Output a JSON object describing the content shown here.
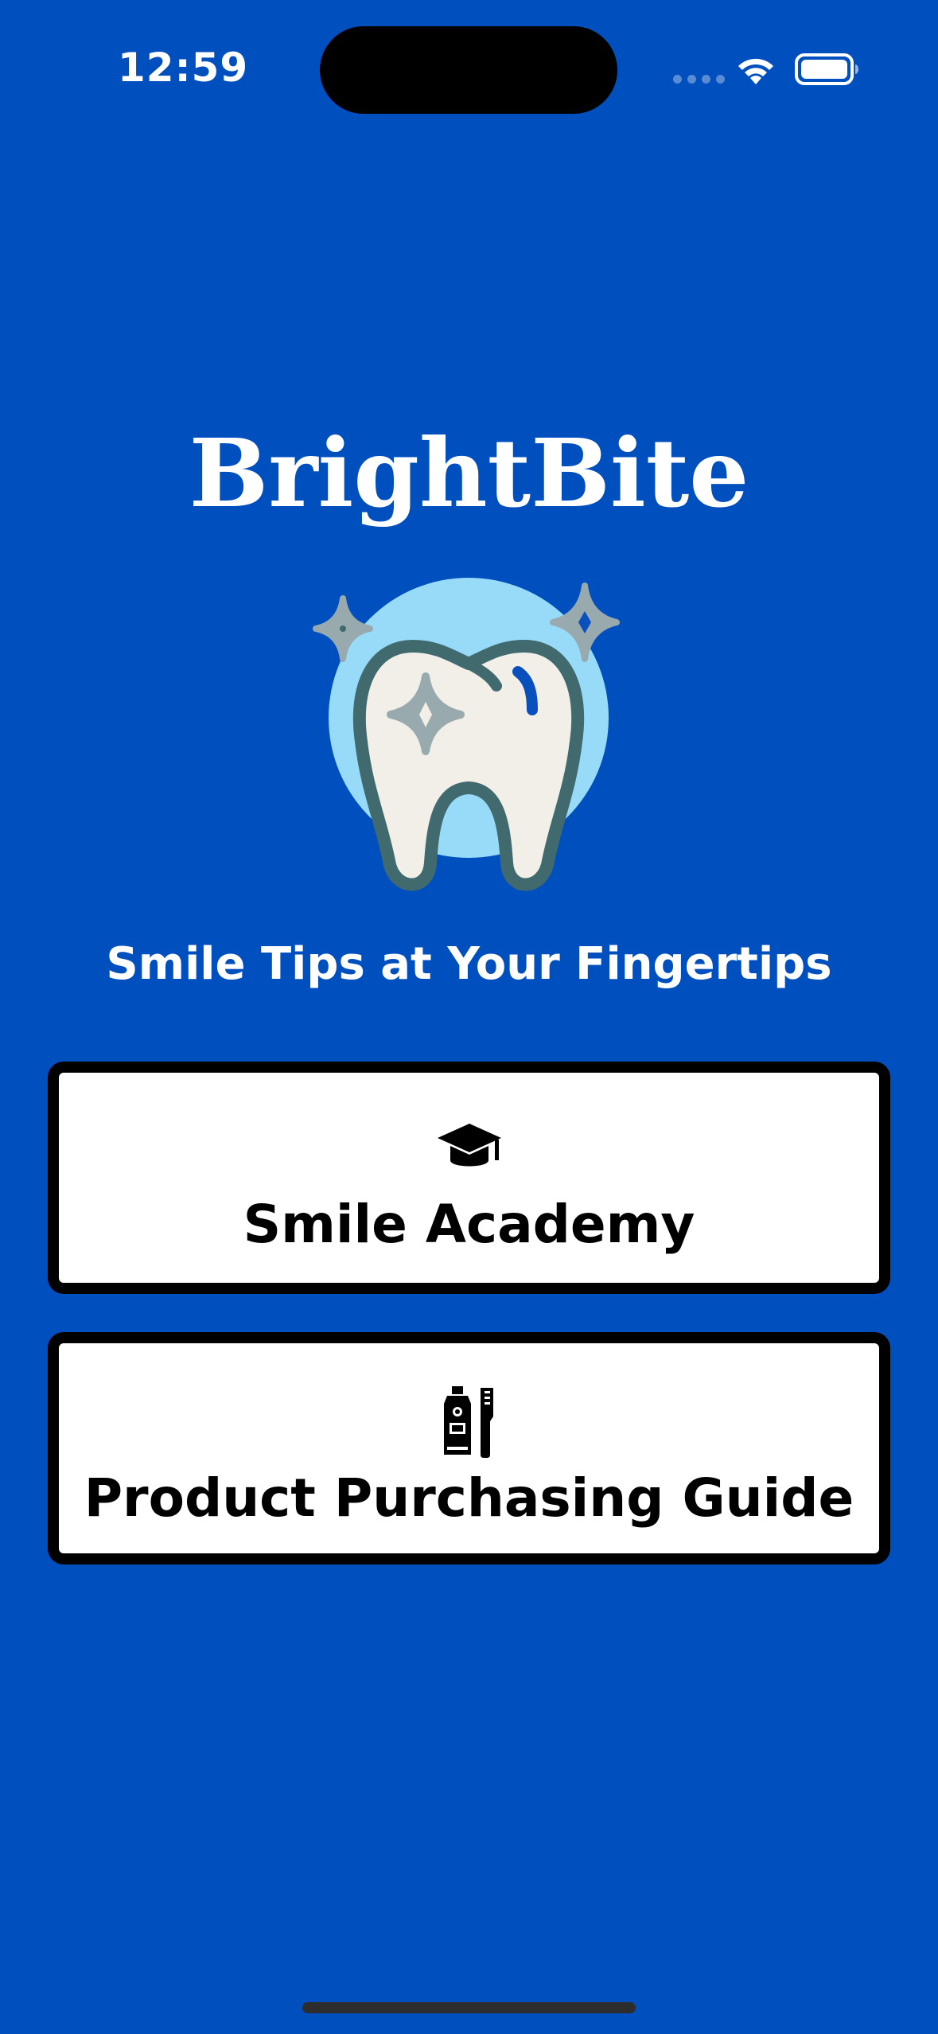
{
  "status_bar": {
    "time": "12:59",
    "icons": [
      "signal-dots-icon",
      "wifi-icon",
      "battery-icon"
    ]
  },
  "app": {
    "title": "BrightBite",
    "logo": "sparkling-tooth-icon",
    "tagline": "Smile Tips at Your Fingertips"
  },
  "menu": {
    "items": [
      {
        "label": "Smile Academy",
        "icon": "graduation-cap-icon"
      },
      {
        "label": "Product Purchasing Guide",
        "icon": "toothpaste-toothbrush-icon"
      }
    ]
  },
  "colors": {
    "background": "#004FBE",
    "button_background": "#FFFFFF",
    "button_border": "#000000",
    "logo_circle": "#98DBF9",
    "tooth_fill": "#F2EFE8",
    "tooth_outline": "#416A6F",
    "sparkle": "#98AAAE"
  }
}
